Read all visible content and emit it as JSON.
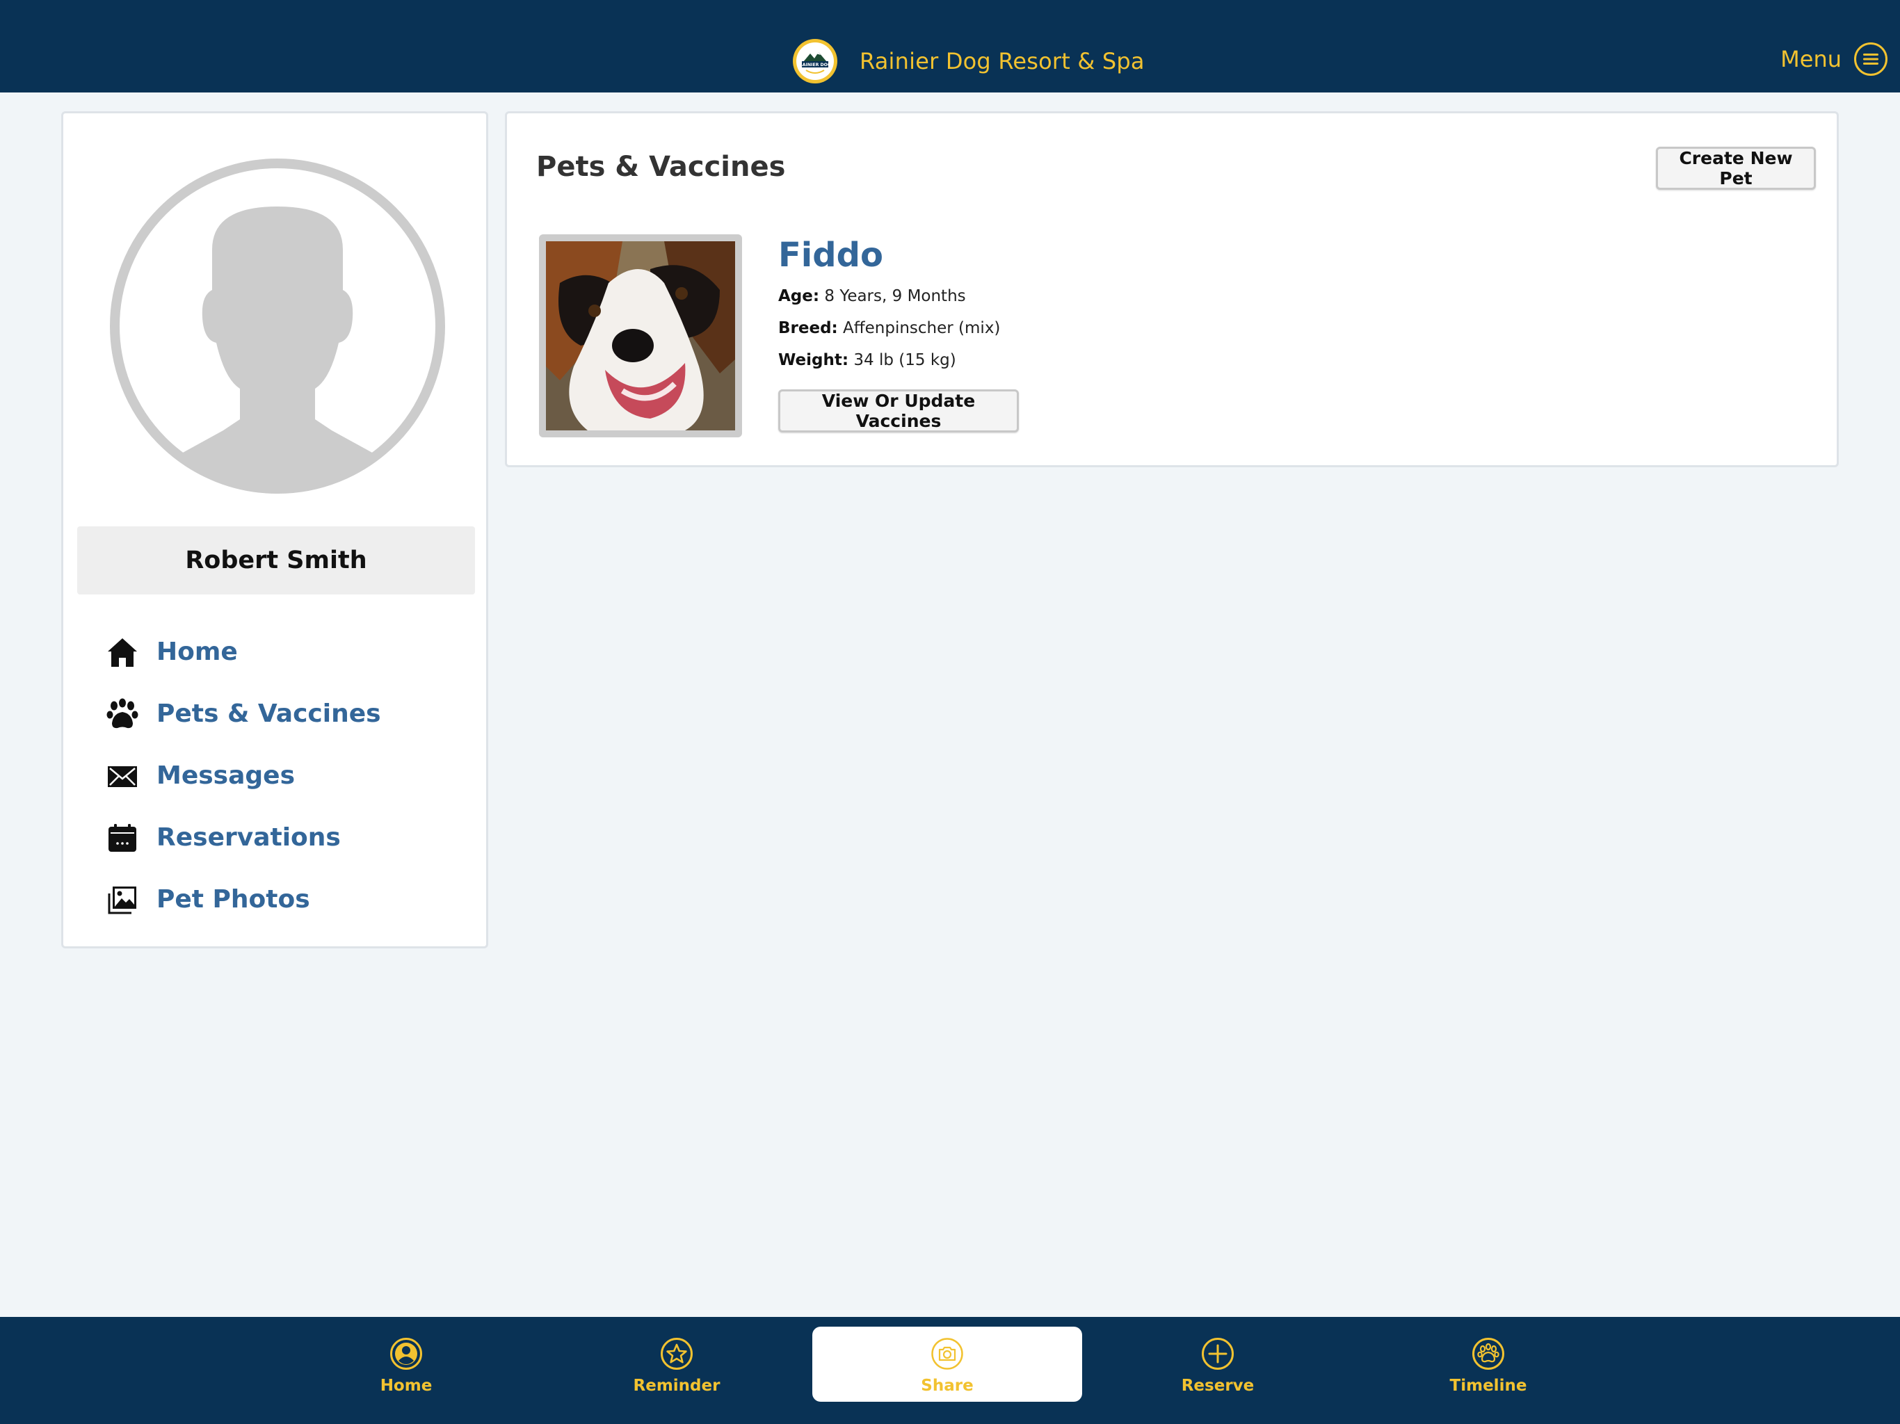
{
  "header": {
    "title": "Rainier Dog Resort & Spa",
    "logo_text": "RAINIER DOG",
    "menu_label": "Menu"
  },
  "sidebar": {
    "profile_name": "Robert Smith",
    "items": [
      {
        "label": "Home",
        "icon": "home-icon"
      },
      {
        "label": "Pets & Vaccines",
        "icon": "paw-icon"
      },
      {
        "label": "Messages",
        "icon": "envelope-icon"
      },
      {
        "label": "Reservations",
        "icon": "calendar-icon"
      },
      {
        "label": "Pet Photos",
        "icon": "photos-icon"
      }
    ]
  },
  "main": {
    "title": "Pets & Vaccines",
    "create_button": "Create New Pet",
    "pets": [
      {
        "name": "Fiddo",
        "age_label": "Age:",
        "age": "8 Years, 9 Months",
        "breed_label": "Breed:",
        "breed": "Affenpinscher (mix)",
        "weight_label": "Weight:",
        "weight": "34 lb (15 kg)",
        "vaccines_button": "View Or Update Vaccines"
      }
    ]
  },
  "tabbar": {
    "items": [
      {
        "label": "Home",
        "icon": "user-circle-icon",
        "active": false
      },
      {
        "label": "Reminder",
        "icon": "star-icon",
        "active": false
      },
      {
        "label": "Share",
        "icon": "camera-icon",
        "active": true
      },
      {
        "label": "Reserve",
        "icon": "plus-circle-icon",
        "active": false
      },
      {
        "label": "Timeline",
        "icon": "paw-circle-icon",
        "active": false
      }
    ]
  },
  "colors": {
    "navy": "#093255",
    "gold": "#f2c230",
    "link_blue": "#336699",
    "background": "#f1f5f8"
  }
}
